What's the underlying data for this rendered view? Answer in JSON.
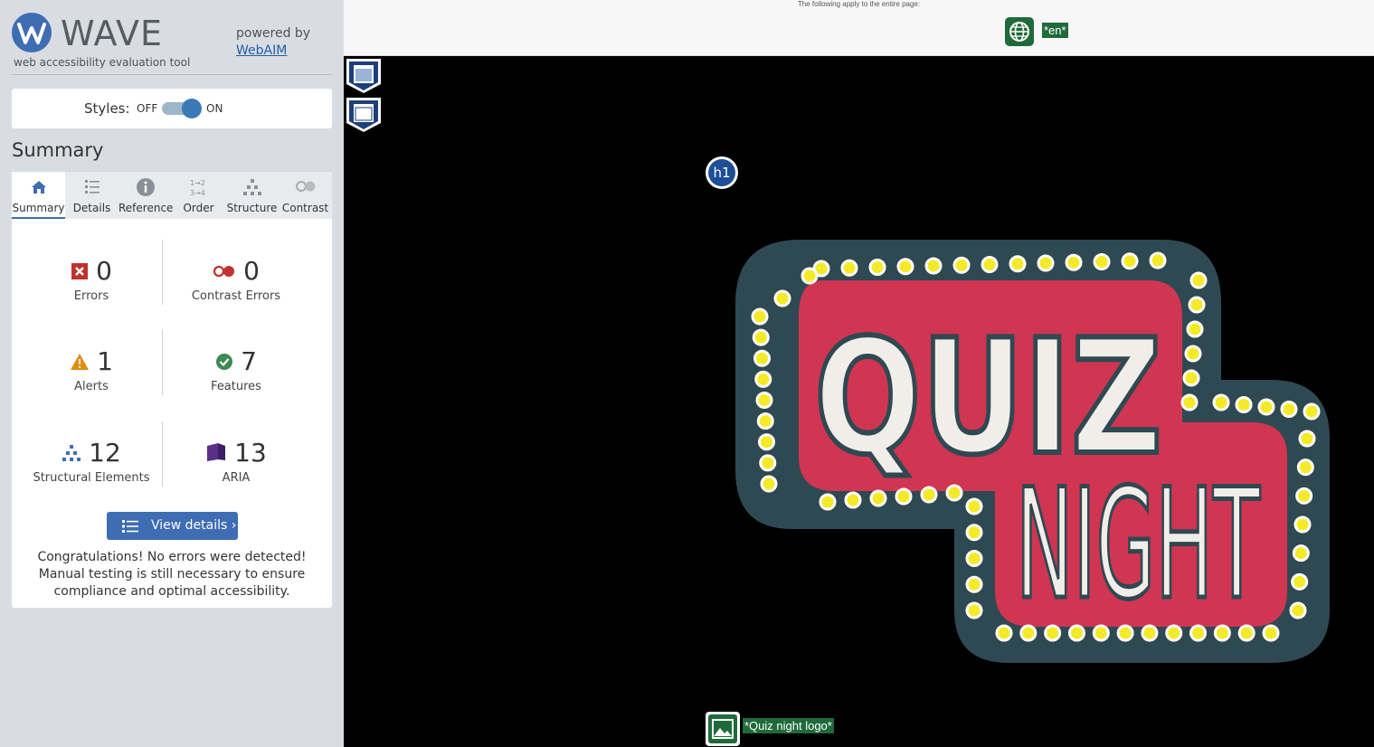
{
  "sidebar": {
    "logo_title": "WAVE",
    "logo_subtitle": "web accessibility evaluation tool",
    "powered_by": "powered by",
    "webaim_link": "WebAIM",
    "styles": {
      "label": "Styles:",
      "off": "OFF",
      "on": "ON",
      "state": "on"
    },
    "summary_heading": "Summary",
    "tabs": [
      {
        "label": "Summary",
        "icon": "home-icon",
        "active": true
      },
      {
        "label": "Details",
        "icon": "list-icon"
      },
      {
        "label": "Reference",
        "icon": "info-icon"
      },
      {
        "label": "Order",
        "icon": "order-icon"
      },
      {
        "label": "Structure",
        "icon": "structure-icon"
      },
      {
        "label": "Contrast",
        "icon": "contrast-icon"
      }
    ],
    "stats": {
      "errors": {
        "value": "0",
        "label": "Errors"
      },
      "contrast_errors": {
        "value": "0",
        "label": "Contrast Errors"
      },
      "alerts": {
        "value": "1",
        "label": "Alerts"
      },
      "features": {
        "value": "7",
        "label": "Features"
      },
      "structural": {
        "value": "12",
        "label": "Structural Elements"
      },
      "aria": {
        "value": "13",
        "label": "ARIA"
      }
    },
    "view_details": "View details ›",
    "congrats": "Congratulations! No errors were detected! Manual testing is still necessary to ensure compliance and optimal accessibility."
  },
  "page": {
    "top_note": "The following apply to the entire page:",
    "language_badge": "*en*",
    "heading_badge": "h1",
    "alt_text_badge": "*Quiz night logo*",
    "logo_words": [
      "QUIZ",
      "NIGHT"
    ]
  },
  "colors": {
    "accent": "#3f6db3",
    "feature_green": "#1f6a3a",
    "error_red": "#c0312f",
    "alert_orange": "#e28b10",
    "aria_purple": "#5a2f8a",
    "logo_pink": "#d03552",
    "logo_teal": "#2f4952",
    "bulb_yellow": "#f4ea28"
  }
}
